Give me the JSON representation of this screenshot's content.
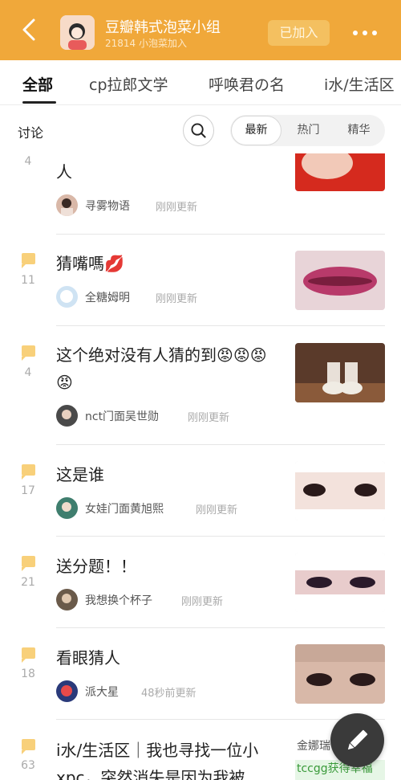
{
  "header": {
    "title": "豆瓣韩式泡菜小组",
    "subtitle": "21814 小泡菜加入",
    "joined_label": "已加入"
  },
  "tabs": [
    {
      "label": "全部",
      "active": true
    },
    {
      "label": "cp拉郎文学"
    },
    {
      "label": "呼唤君の名"
    },
    {
      "label": "i水/生活区"
    }
  ],
  "filter": {
    "label": "讨论",
    "options": [
      {
        "label": "最新",
        "active": true
      },
      {
        "label": "热门"
      },
      {
        "label": "精华"
      }
    ]
  },
  "posts": [
    {
      "count": "4",
      "title": "人",
      "author": "寻雾物语",
      "time": "刚刚更新"
    },
    {
      "count": "11",
      "title": "猜嘴嗎💋",
      "author": "全糖姆明",
      "time": "刚刚更新"
    },
    {
      "count": "4",
      "title": "这个绝对没有人猜的到😡😡😡😡",
      "author": "nct门面吴世勋",
      "time": "刚刚更新"
    },
    {
      "count": "17",
      "title": "这是谁",
      "author": "女娃门面黄旭熙",
      "time": "刚刚更新"
    },
    {
      "count": "21",
      "title": "送分题！！",
      "author": "我想换个杯子",
      "time": "刚刚更新"
    },
    {
      "count": "18",
      "title": "看眼猜人",
      "author": "派大星",
      "time": "48秒前更新"
    },
    {
      "count": "63",
      "title": "i水/生活区｜我也寻找一位小xpc，突然消失是因为我被",
      "thumb_text_top": "金娜瑞",
      "thumb_text_bottom": "tccgg获得幸福"
    }
  ],
  "colors": {
    "brand": "#f0a83a",
    "flag": "#f8d07a"
  },
  "icons": {
    "back": "chevron-left-icon",
    "more": "more-icon",
    "search": "search-icon",
    "compose": "pencil-icon"
  }
}
